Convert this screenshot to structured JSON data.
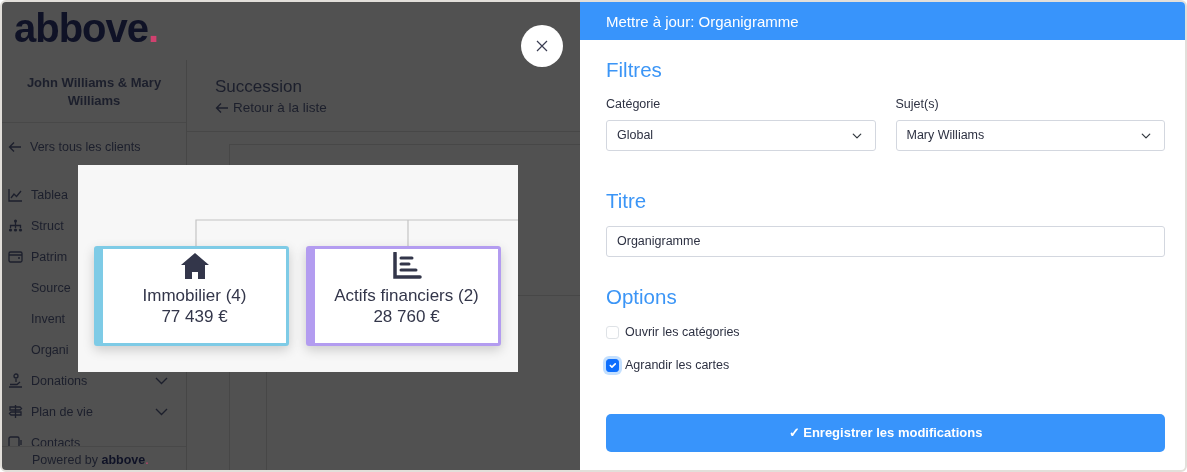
{
  "logo": {
    "name": "abbove",
    "dot": "."
  },
  "client": "John Williams & Mary Williams",
  "back_to_clients": "Vers tous les clients",
  "nav": [
    {
      "kind": "dashboard",
      "label": "Tablea"
    },
    {
      "kind": "structure",
      "label": "Struct"
    },
    {
      "kind": "assets",
      "label": "Patrim"
    },
    {
      "kind": "sub",
      "label": "Source"
    },
    {
      "kind": "sub",
      "label": "Invent"
    },
    {
      "kind": "sub",
      "label": "Organi"
    },
    {
      "kind": "donations",
      "label": "Donations",
      "expanded": false
    },
    {
      "kind": "plan",
      "label": "Plan de vie",
      "expanded": false
    },
    {
      "kind": "contacts",
      "label": "Contacts"
    }
  ],
  "footer": {
    "text": "Powered by",
    "brand": "abbove",
    "dot": "."
  },
  "page": {
    "title": "Succession",
    "back": "Retour à la liste"
  },
  "preview": {
    "cards": [
      {
        "kind": "house",
        "title": "Immobilier (4)",
        "amount": "77 439 €",
        "color": "#7ecbe6"
      },
      {
        "kind": "chart",
        "title": "Actifs financiers (2)",
        "amount": "28 760 €",
        "color": "#b39cf0"
      }
    ]
  },
  "panel": {
    "title": "Mettre à jour: Organigramme",
    "filters": {
      "heading": "Filtres",
      "fields": [
        {
          "label": "Catégorie",
          "value": "Global"
        },
        {
          "label": "Sujet(s)",
          "value": "Mary Williams"
        }
      ]
    },
    "title_section": {
      "heading": "Titre",
      "value": "Organigramme"
    },
    "options": {
      "heading": "Options",
      "items": [
        {
          "label": "Ouvrir les catégories",
          "checked": false
        },
        {
          "label": "Agrandir les cartes",
          "checked": true
        }
      ]
    },
    "submit": "✓ Enregistrer les modifications"
  }
}
